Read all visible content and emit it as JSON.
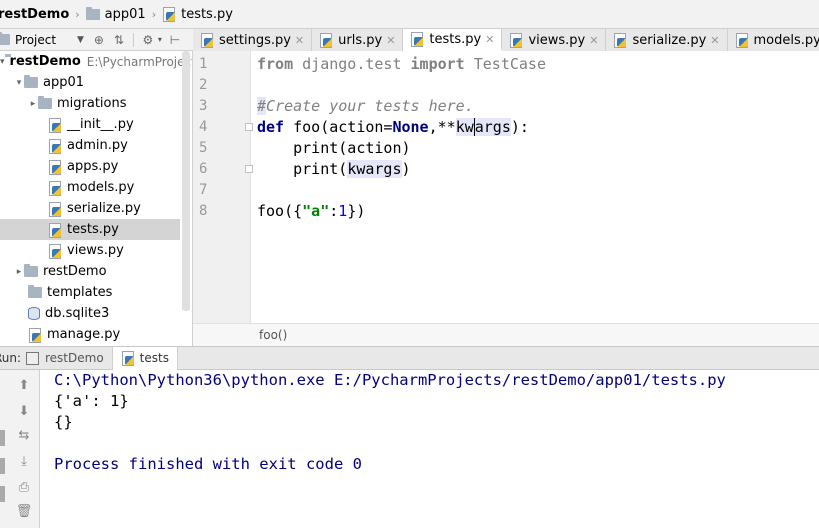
{
  "breadcrumb": [
    "restDemo",
    "app01",
    "tests.py"
  ],
  "project_toolbar": {
    "label": "Project"
  },
  "editor_tabs": [
    {
      "label": "settings.py",
      "active": false
    },
    {
      "label": "urls.py",
      "active": false
    },
    {
      "label": "tests.py",
      "active": true
    },
    {
      "label": "views.py",
      "active": false
    },
    {
      "label": "serialize.py",
      "active": false
    },
    {
      "label": "models.py",
      "active": false
    }
  ],
  "tree": {
    "root_name": "restDemo",
    "root_path": "E:\\PycharmProjects\\restDemo",
    "items": [
      {
        "label": "app01",
        "type": "folder",
        "depth": 1,
        "expanded": true
      },
      {
        "label": "migrations",
        "type": "folder",
        "depth": 2,
        "expanded": false
      },
      {
        "label": "__init__.py",
        "type": "py",
        "depth": 2
      },
      {
        "label": "admin.py",
        "type": "py",
        "depth": 2
      },
      {
        "label": "apps.py",
        "type": "py",
        "depth": 2
      },
      {
        "label": "models.py",
        "type": "py",
        "depth": 2
      },
      {
        "label": "serialize.py",
        "type": "py",
        "depth": 2
      },
      {
        "label": "tests.py",
        "type": "py",
        "depth": 2,
        "selected": true
      },
      {
        "label": "views.py",
        "type": "py",
        "depth": 2
      },
      {
        "label": "restDemo",
        "type": "folder",
        "depth": 1,
        "expanded": false
      },
      {
        "label": "templates",
        "type": "folder",
        "depth": 1
      },
      {
        "label": "db.sqlite3",
        "type": "db",
        "depth": 1
      },
      {
        "label": "manage.py",
        "type": "py",
        "depth": 1
      }
    ]
  },
  "editor": {
    "lines": [
      "1",
      "2",
      "3",
      "4",
      "5",
      "6",
      "7",
      "8"
    ],
    "code": {
      "l1_from": "from",
      "l1_mod": " django.test ",
      "l1_import": "import",
      "l1_name": " TestCase",
      "l3_hash": "#",
      "l3_comment": "Create your tests here.",
      "l4_def": "def",
      "l4_a": " foo(action=",
      "l4_none": "None",
      "l4_b": ",**",
      "l4_kw1": "kw",
      "l4_kw2": "args",
      "l4_c": "):",
      "l5": "    print(action)",
      "l6_a": "    print(",
      "l6_kw": "kwargs",
      "l6_b": ")",
      "l8_a": "foo({",
      "l8_str": "\"a\"",
      "l8_b": ":",
      "l8_num": "1",
      "l8_c": "})"
    },
    "footer_crumb": "foo()"
  },
  "run": {
    "label": "Run:",
    "tabs": [
      {
        "label": "restDemo",
        "active": false
      },
      {
        "label": "tests",
        "active": true
      }
    ],
    "output": [
      {
        "text": "C:\\Python\\Python36\\python.exe E:/PycharmProjects/restDemo/app01/tests.py",
        "color": "#000080"
      },
      {
        "text": "{'a': 1}",
        "color": "#000000"
      },
      {
        "text": "{}",
        "color": "#000000"
      },
      {
        "text": "",
        "color": "#000000"
      },
      {
        "text": "Process finished with exit code 0",
        "color": "#000080"
      }
    ]
  }
}
